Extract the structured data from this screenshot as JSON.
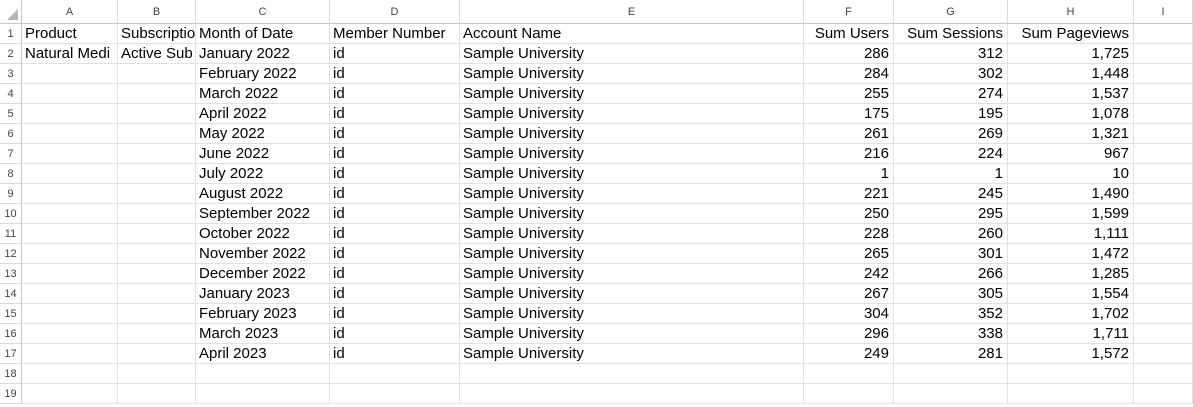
{
  "columns": [
    "A",
    "B",
    "C",
    "D",
    "E",
    "F",
    "G",
    "H",
    "I"
  ],
  "row_numbers": [
    "1",
    "2",
    "3",
    "4",
    "5",
    "6",
    "7",
    "8",
    "9",
    "10",
    "11",
    "12",
    "13",
    "14",
    "15",
    "16",
    "17",
    "18",
    "19"
  ],
  "header_cells": {
    "product": "Product",
    "subscription": "Subscriptio",
    "month": "Month of Date",
    "member": "Member Number",
    "account": "Account Name",
    "users": "Sum Users",
    "sessions": "Sum Sessions",
    "pageviews": "Sum Pageviews"
  },
  "first_row_extra": {
    "product": "Natural Medi",
    "subscription": "Active Sub"
  },
  "rows": [
    {
      "month": "January 2022",
      "member": "id",
      "account": "Sample University",
      "users": "286",
      "sessions": "312",
      "pageviews": "1,725"
    },
    {
      "month": "February 2022",
      "member": "id",
      "account": "Sample University",
      "users": "284",
      "sessions": "302",
      "pageviews": "1,448"
    },
    {
      "month": "March 2022",
      "member": "id",
      "account": "Sample University",
      "users": "255",
      "sessions": "274",
      "pageviews": "1,537"
    },
    {
      "month": "April 2022",
      "member": "id",
      "account": "Sample University",
      "users": "175",
      "sessions": "195",
      "pageviews": "1,078"
    },
    {
      "month": "May 2022",
      "member": "id",
      "account": "Sample University",
      "users": "261",
      "sessions": "269",
      "pageviews": "1,321"
    },
    {
      "month": "June 2022",
      "member": "id",
      "account": "Sample University",
      "users": "216",
      "sessions": "224",
      "pageviews": "967"
    },
    {
      "month": "July 2022",
      "member": "id",
      "account": "Sample University",
      "users": "1",
      "sessions": "1",
      "pageviews": "10"
    },
    {
      "month": "August 2022",
      "member": "id",
      "account": "Sample University",
      "users": "221",
      "sessions": "245",
      "pageviews": "1,490"
    },
    {
      "month": "September 2022",
      "member": "id",
      "account": "Sample University",
      "users": "250",
      "sessions": "295",
      "pageviews": "1,599"
    },
    {
      "month": "October 2022",
      "member": "id",
      "account": "Sample University",
      "users": "228",
      "sessions": "260",
      "pageviews": "1,111"
    },
    {
      "month": "November 2022",
      "member": "id",
      "account": "Sample University",
      "users": "265",
      "sessions": "301",
      "pageviews": "1,472"
    },
    {
      "month": "December 2022",
      "member": "id",
      "account": "Sample University",
      "users": "242",
      "sessions": "266",
      "pageviews": "1,285"
    },
    {
      "month": "January 2023",
      "member": "id",
      "account": "Sample University",
      "users": "267",
      "sessions": "305",
      "pageviews": "1,554"
    },
    {
      "month": "February 2023",
      "member": "id",
      "account": "Sample University",
      "users": "304",
      "sessions": "352",
      "pageviews": "1,702"
    },
    {
      "month": "March 2023",
      "member": "id",
      "account": "Sample University",
      "users": "296",
      "sessions": "338",
      "pageviews": "1,711"
    },
    {
      "month": "April 2023",
      "member": "id",
      "account": "Sample University",
      "users": "249",
      "sessions": "281",
      "pageviews": "1,572"
    }
  ]
}
